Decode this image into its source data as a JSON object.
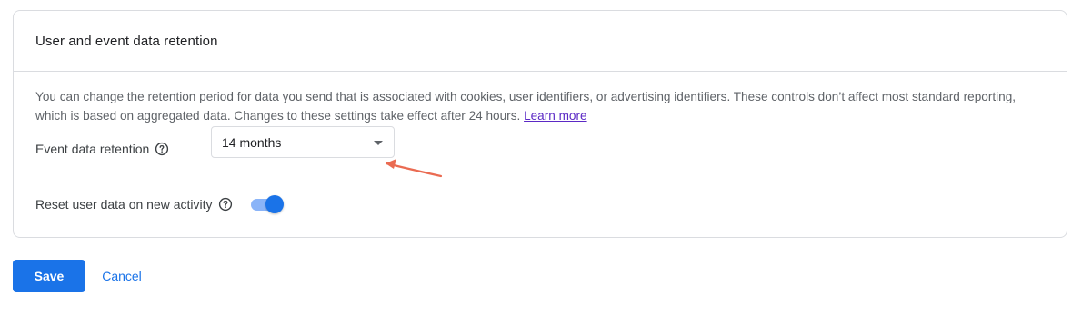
{
  "card": {
    "title": "User and event data retention",
    "description": "You can change the retention period for data you send that is associated with cookies, user identifiers, or advertising identifiers. These controls don’t affect most standard reporting, which is based on aggregated data. Changes to these settings take effect after 24 hours.",
    "learn_more": "Learn more"
  },
  "event_retention": {
    "label": "Event data retention",
    "value": "14 months"
  },
  "reset_user_data": {
    "label": "Reset user data on new activity",
    "enabled": true
  },
  "actions": {
    "save": "Save",
    "cancel": "Cancel"
  },
  "colors": {
    "primary": "#1a73e8",
    "toggle_track": "#8ab4f8",
    "link": "#5b29c5",
    "annotation_arrow": "#ea6b52"
  },
  "icons": {
    "help": "help-circle-icon",
    "dropdown": "caret-down-icon",
    "annotation": "arrow-pointer-icon"
  }
}
